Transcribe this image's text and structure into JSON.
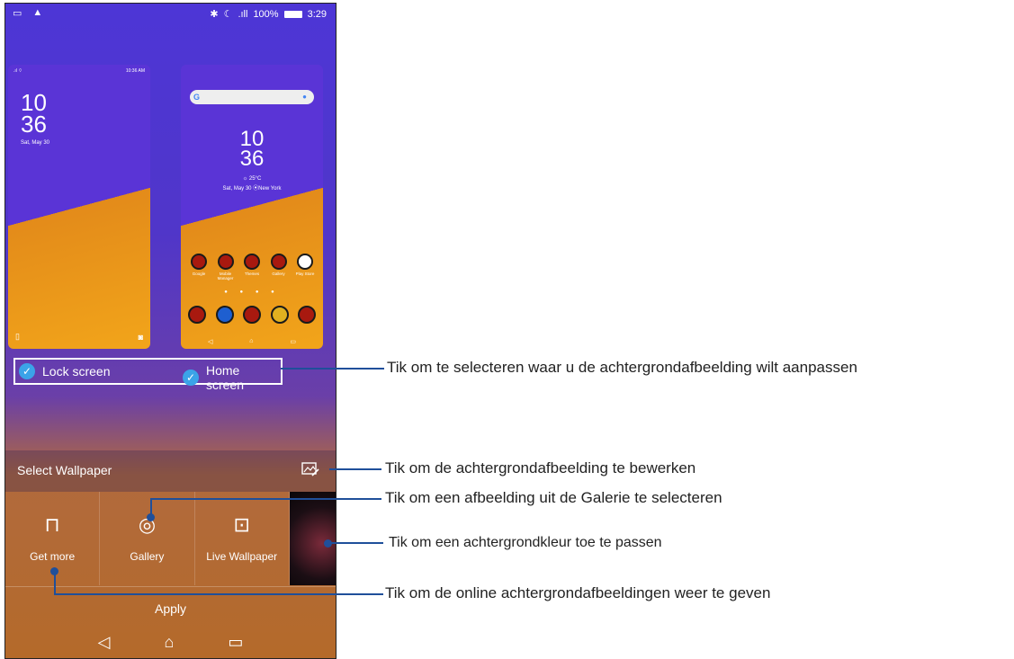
{
  "status": {
    "time": "3:29",
    "battery": "100%"
  },
  "lock_preview": {
    "status_time": "10:36 AM",
    "hour": "10",
    "minute": "36",
    "date": "Sat, May 30"
  },
  "home_preview": {
    "hour": "10",
    "minute": "36",
    "temp": "☼ 25°C",
    "date": "Sat, May 30 ⦿New York",
    "apps": [
      "Google",
      "Mobile Manager",
      "Themes",
      "Gallery",
      "Play Store"
    ]
  },
  "options": {
    "lock_label": "Lock screen",
    "home_label": "Home screen"
  },
  "panel": {
    "title": "Select Wallpaper",
    "tiles": [
      {
        "label": "Get more",
        "icon": "paint-roller-icon"
      },
      {
        "label": "Gallery",
        "icon": "balloon-icon"
      },
      {
        "label": "Live Wallpaper",
        "icon": "live-wallpaper-icon"
      }
    ],
    "apply": "Apply"
  },
  "annotations": {
    "a1": "Tik om te selecteren waar u de achtergrondafbeelding wilt aanpassen",
    "a2": "Tik om de achtergrondafbeelding te bewerken",
    "a3": "Tik om een afbeelding uit de Galerie te selecteren",
    "a4": "Tik om een achtergrondkleur toe te passen",
    "a5": "Tik om de online achtergrondafbeeldingen weer te geven"
  },
  "colors": {
    "accent": "#3ba3e8",
    "callout": "#1f4f9a"
  }
}
